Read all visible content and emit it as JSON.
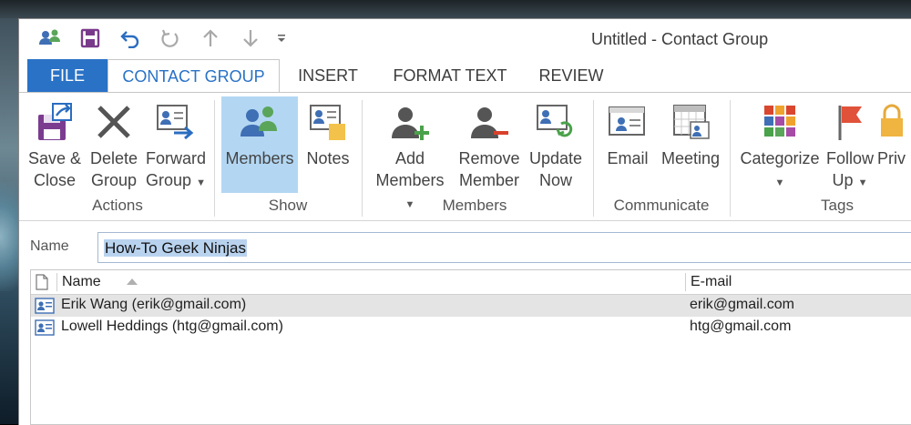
{
  "window": {
    "title": "Untitled - Contact Group"
  },
  "tabs": [
    {
      "label": "FILE"
    },
    {
      "label": "CONTACT GROUP"
    },
    {
      "label": "INSERT"
    },
    {
      "label": "FORMAT TEXT"
    },
    {
      "label": "REVIEW"
    }
  ],
  "ribbon": {
    "actions": {
      "group": "Actions",
      "save": [
        "Save &",
        "Close"
      ],
      "delete": [
        "Delete",
        "Group"
      ],
      "forward": [
        "Forward",
        "Group"
      ]
    },
    "show": {
      "group": "Show",
      "members": "Members",
      "notes": "Notes"
    },
    "members": {
      "group": "Members",
      "add": [
        "Add",
        "Members"
      ],
      "remove": [
        "Remove",
        "Member"
      ],
      "update": [
        "Update",
        "Now"
      ]
    },
    "communicate": {
      "group": "Communicate",
      "email": "Email",
      "meeting": "Meeting"
    },
    "tags": {
      "group": "Tags",
      "categorize": "Categorize",
      "follow": [
        "Follow",
        "Up"
      ],
      "private": "Priv"
    }
  },
  "name_field": {
    "label": "Name",
    "value": "How-To Geek Ninjas"
  },
  "list": {
    "columns": {
      "name": "Name",
      "email": "E-mail"
    },
    "rows": [
      {
        "name": "Erik Wang (erik@gmail.com)",
        "email": "erik@gmail.com",
        "selected": true
      },
      {
        "name": "Lowell Heddings (htg@gmail.com)",
        "email": "htg@gmail.com",
        "selected": false
      }
    ]
  },
  "colors": {
    "accent": "#2a72c6",
    "selected_button": "#b3d7f3"
  }
}
